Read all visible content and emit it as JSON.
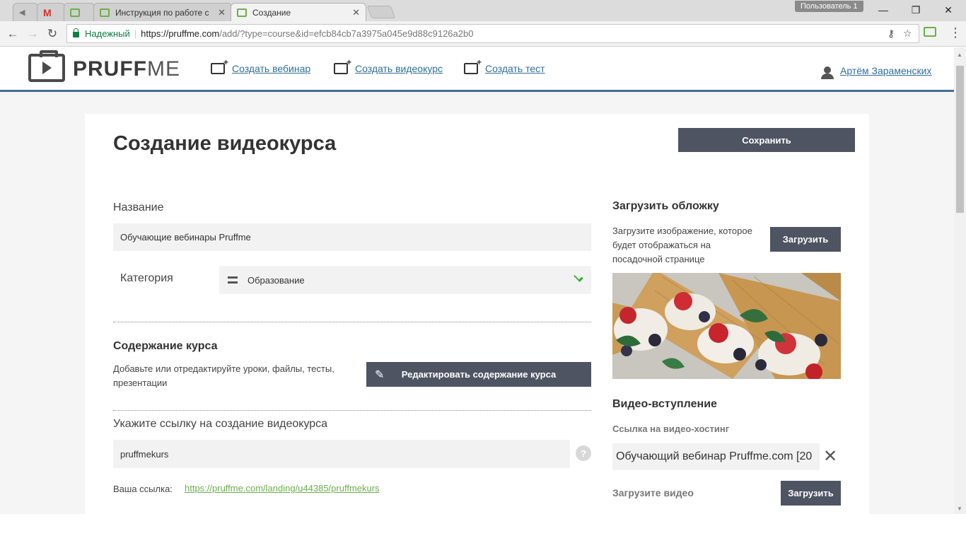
{
  "browser": {
    "tabs": [
      {
        "label": ""
      },
      {
        "label": ""
      },
      {
        "label": ""
      },
      {
        "label": "Инструкция по работе с"
      },
      {
        "label": "Создание"
      }
    ],
    "profile": "Пользователь 1",
    "secure_label": "Надежный",
    "url_host": "https://pruffme.com",
    "url_rest": "/add/?type=course&id=efcb84cb7a3975a045e9d88c9126a2b0"
  },
  "header": {
    "logo_bold": "PRUFF",
    "logo_light": "ME",
    "nav": [
      {
        "label": "Создать вебинар"
      },
      {
        "label": "Создать видеокурс"
      },
      {
        "label": "Создать тест"
      }
    ],
    "user": "Артём Зараменских"
  },
  "form": {
    "title": "Создание видеокурса",
    "save_label": "Сохранить",
    "name_label": "Название",
    "name_value": "Обучающие вебинары Pruffme",
    "category_label": "Категория",
    "category_value": "Образование",
    "content_heading": "Содержание курса",
    "content_hint": "Добавьте или отредактируйте уроки, файлы, тесты, презентации",
    "edit_content_label": "Редактировать содержание курса",
    "link_label": "Укажите ссылку на создание видеокурса",
    "link_value": "pruffmekurs",
    "help_symbol": "?",
    "your_link_label": "Ваша ссылка:",
    "your_link_url": "https://pruffme.com/landing/u44385/pruffmekurs"
  },
  "sidebar": {
    "cover_heading": "Загрузить обложку",
    "cover_hint": "Загрузите изображение, которое будет отображаться на посадочной странице",
    "upload_label": "Загрузить",
    "video_heading": "Видео-вступление",
    "video_link_label": "Ссылка на видео-хостинг",
    "video_link_value": "Обучающий вебинар Pruffme.com [20",
    "upload_video_label": "Загрузите видео",
    "upload_video_button": "Загрузить"
  },
  "colors": {
    "accent_blue": "#3f6f96",
    "button_dark": "#4e5462",
    "link_green": "#6ab04c"
  }
}
